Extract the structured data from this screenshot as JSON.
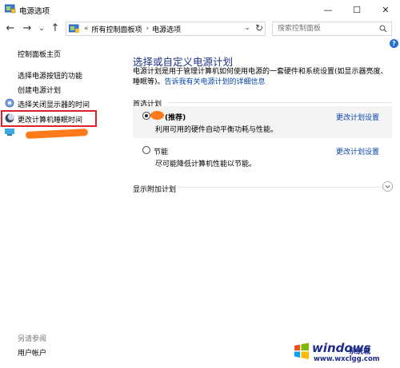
{
  "window": {
    "title": "电源选项",
    "minimize_glyph": "—",
    "maximize_glyph": "☐",
    "close_glyph": "✕"
  },
  "nav": {
    "back_glyph": "←",
    "forward_glyph": "→",
    "recent_glyph": "⌄",
    "up_glyph": "↑"
  },
  "address_bar": {
    "prefix": "«",
    "breadcrumbs": [
      "所有控制面板项",
      "电源选项"
    ],
    "separator": "›",
    "dropdown_glyph": "⌄",
    "refresh_glyph": "↻"
  },
  "search": {
    "placeholder": "搜索控制面板"
  },
  "help": {
    "glyph": "?"
  },
  "sidebar": {
    "items": [
      {
        "label": "控制面板主页"
      },
      {
        "label": "选择电源按钮的功能"
      },
      {
        "label": "创建电源计划"
      },
      {
        "label": "选择关闭显示器的时间"
      },
      {
        "label": "更改计算机睡眠时间"
      }
    ],
    "see_also": "另请参阅",
    "user_accounts": "用户帐户"
  },
  "main": {
    "title": "选择或自定义电源计划",
    "description": "电源计划是用于管理计算机如何使用电源的一套硬件和系统设置(如显示器亮度、睡眠等)。",
    "link": "告诉我有关电源计划的详细信息",
    "preferred_label": "首选计划",
    "plans": [
      {
        "name": "(推荐)",
        "desc": "利用可用的硬件自动平衡功耗与性能。",
        "change": "更改计划设置",
        "selected": true
      },
      {
        "name": "节能",
        "desc": "尽可能降低计算机性能以节能。",
        "change": "更改计划设置",
        "selected": false
      }
    ],
    "more_label": "显示附加计划"
  },
  "watermark": {
    "brand": "windows",
    "sub": "系统城",
    "url": "www.wxclgg.com"
  },
  "colors": {
    "title_blue": "#1e3287",
    "link_blue": "#0645ad",
    "highlight_red": "#e0202a",
    "redaction_orange": "#ff7a1a"
  }
}
